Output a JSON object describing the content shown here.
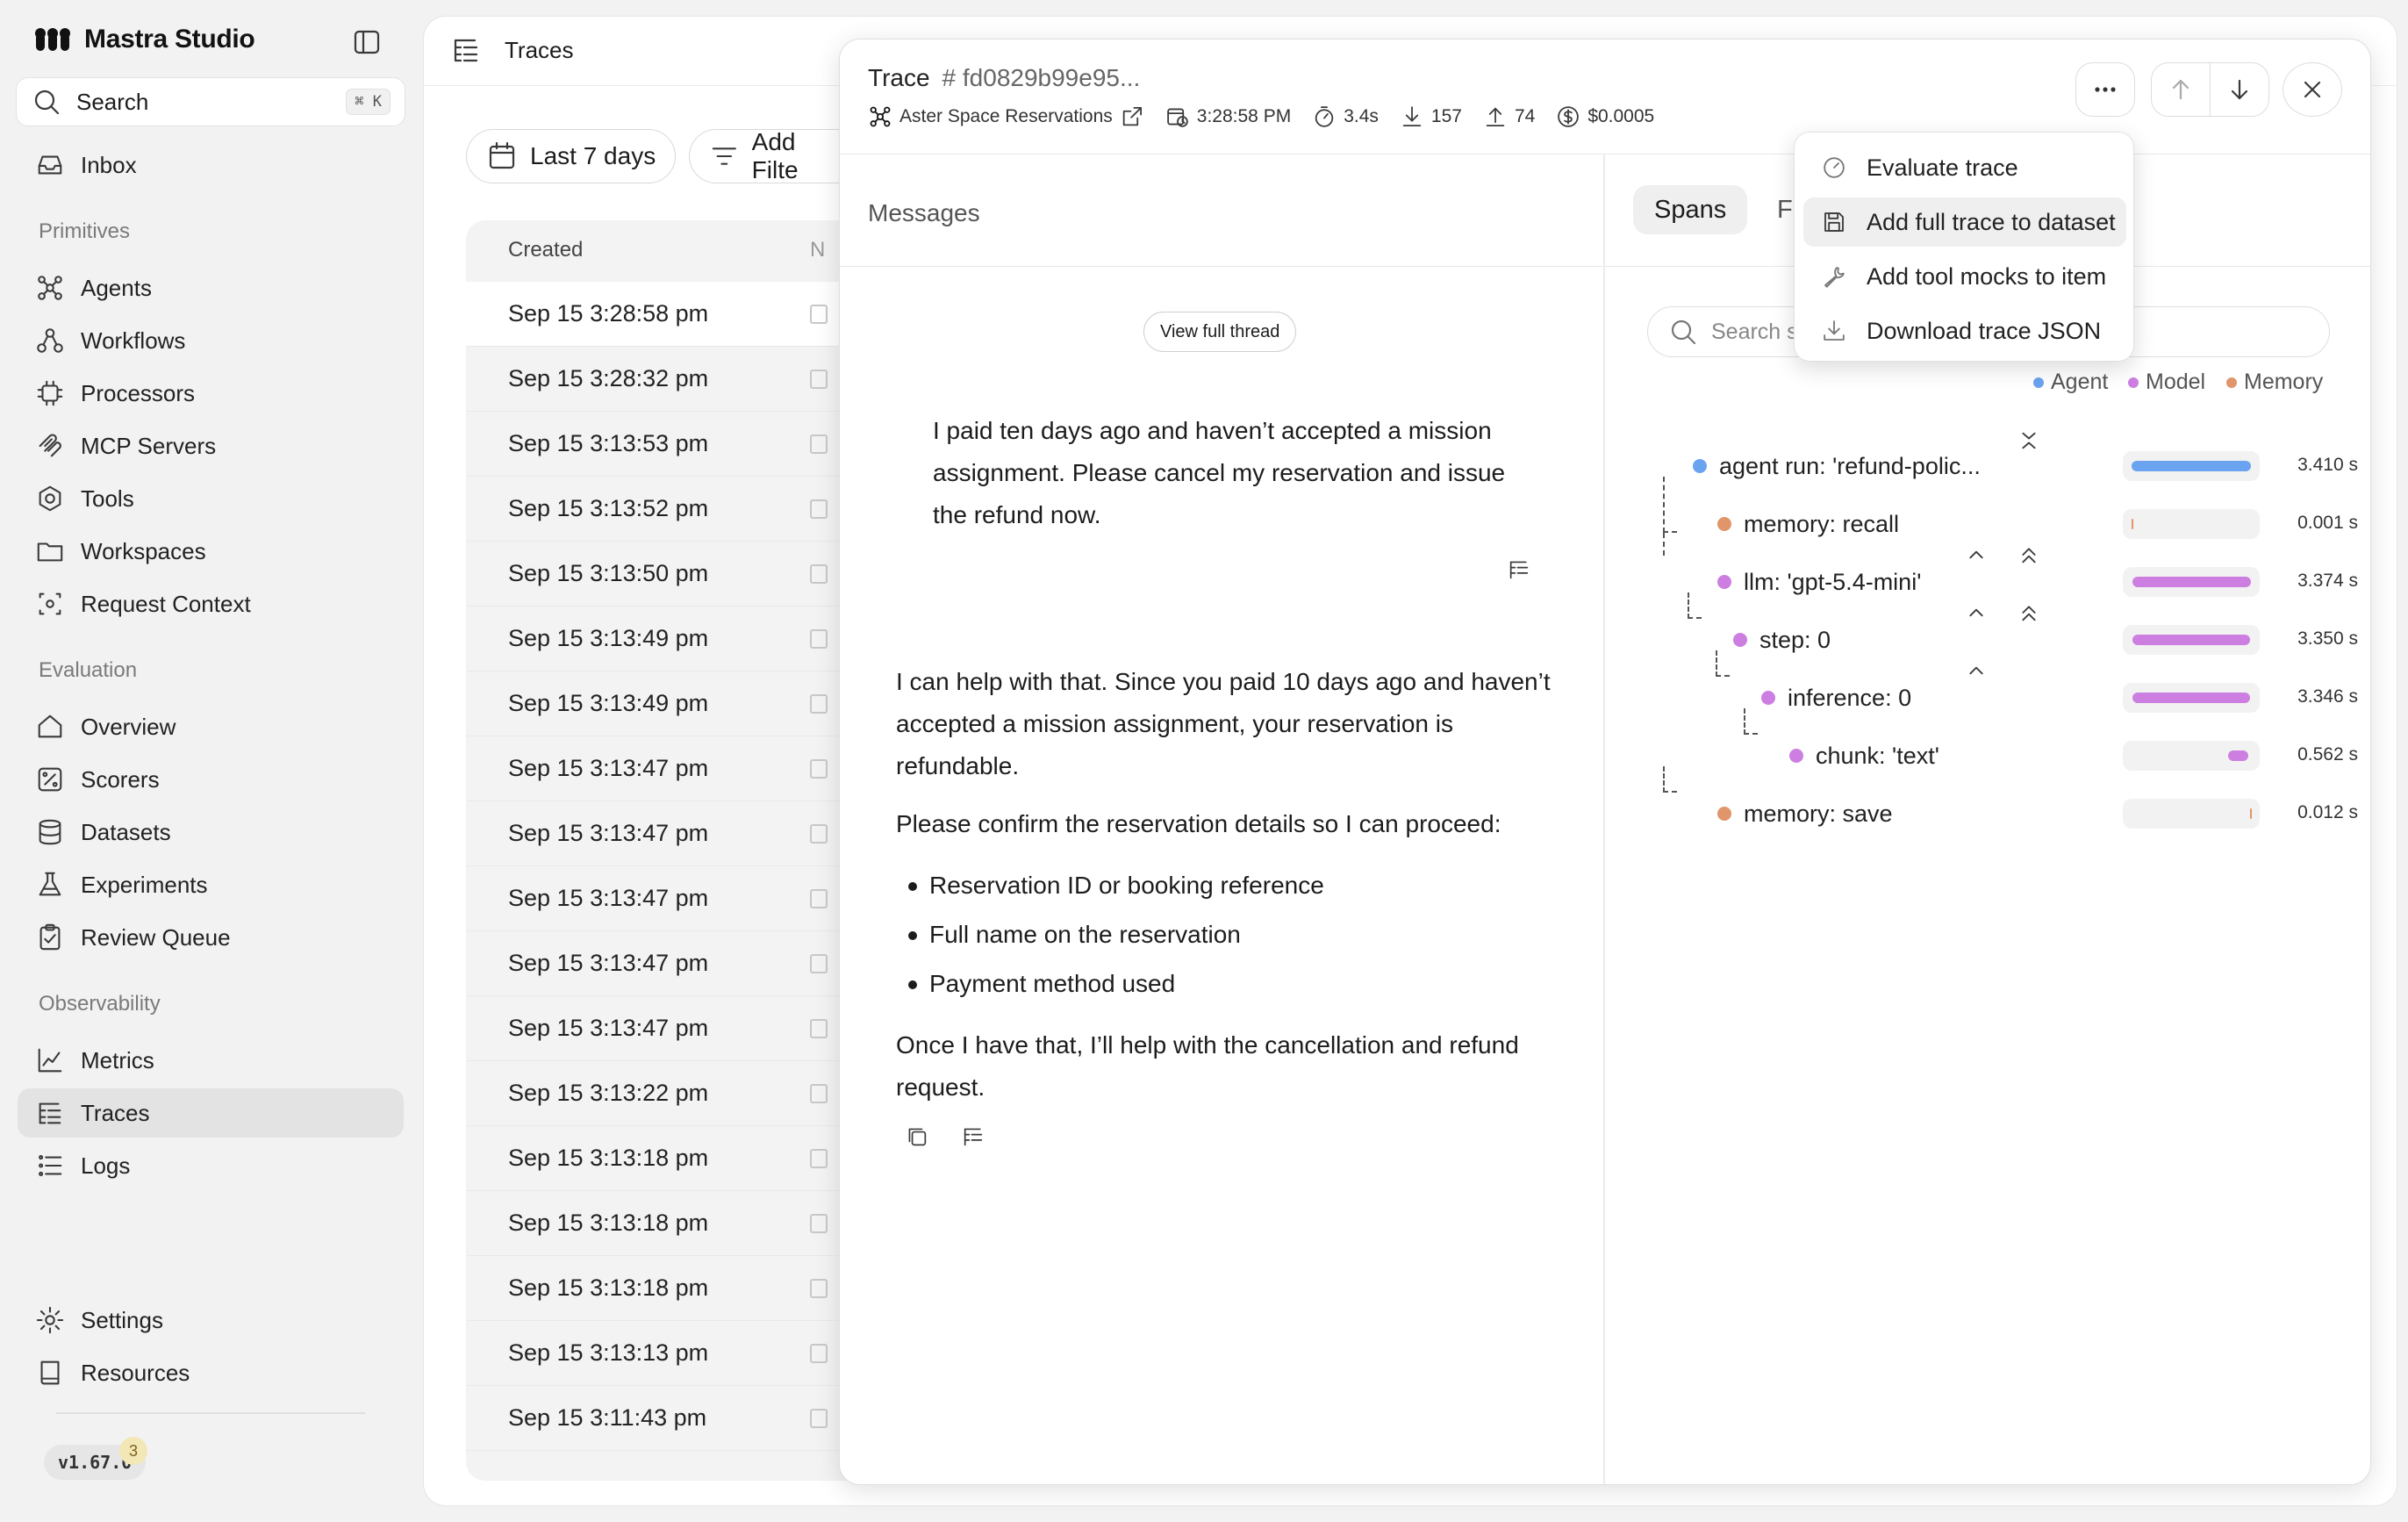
{
  "app": {
    "name": "Mastra Studio",
    "version": "v1.67.0",
    "version_badge": "3"
  },
  "sidebar": {
    "search_label": "Search",
    "search_shortcut": "⌘ K",
    "inbox": "Inbox",
    "sections": {
      "primitives": "Primitives",
      "evaluation": "Evaluation",
      "observability": "Observability"
    },
    "primitives": [
      "Agents",
      "Workflows",
      "Processors",
      "MCP Servers",
      "Tools",
      "Workspaces",
      "Request Context"
    ],
    "evaluation": [
      "Overview",
      "Scorers",
      "Datasets",
      "Experiments",
      "Review Queue"
    ],
    "observability": [
      "Metrics",
      "Traces",
      "Logs"
    ],
    "active": "Traces",
    "footer": [
      "Settings",
      "Resources"
    ]
  },
  "main": {
    "title": "Traces",
    "filters": {
      "date_range": "Last 7 days",
      "add_filter": "Add Filte"
    },
    "table": {
      "column_created": "Created",
      "column_name": "N",
      "rows": [
        "Sep 15 3:28:58 pm",
        "Sep 15 3:28:32 pm",
        "Sep 15 3:13:53 pm",
        "Sep 15 3:13:52 pm",
        "Sep 15 3:13:50 pm",
        "Sep 15 3:13:49 pm",
        "Sep 15 3:13:49 pm",
        "Sep 15 3:13:47 pm",
        "Sep 15 3:13:47 pm",
        "Sep 15 3:13:47 pm",
        "Sep 15 3:13:47 pm",
        "Sep 15 3:13:47 pm",
        "Sep 15 3:13:22 pm",
        "Sep 15 3:13:18 pm",
        "Sep 15 3:13:18 pm",
        "Sep 15 3:13:18 pm",
        "Sep 15 3:13:13 pm",
        "Sep 15 3:11:43 pm"
      ]
    }
  },
  "trace": {
    "label": "Trace",
    "id": "# fd0829b99e95...",
    "agent": "Aster Space Reservations",
    "time": "3:28:58 PM",
    "duration": "3.4s",
    "tokens_in": "157",
    "tokens_out": "74",
    "cost": "$0.0005",
    "messages_label": "Messages",
    "view_thread": "View full thread",
    "user_message": "I paid ten days ago and haven’t accepted a mission assignment. Please cancel my reservation and issue the refund now.",
    "assistant": {
      "p1": "I can help with that. Since you paid 10 days ago and haven’t accepted a mission assignment, your reservation is refundable.",
      "p2": "Please confirm the reservation details so I can proceed:",
      "bullets": [
        "Reservation ID or booking reference",
        "Full name on the reservation",
        "Payment method used"
      ],
      "p3": "Once I have that, I’ll help with the cancellation and refund request."
    },
    "tabs": {
      "spans": "Spans",
      "second": "Fe"
    },
    "span_search_placeholder": "Search sp",
    "legend": [
      {
        "name": "Agent",
        "color": "#6aa3f0"
      },
      {
        "name": "Model",
        "color": "#cc7fe0"
      },
      {
        "name": "Memory",
        "color": "#e0956a"
      }
    ],
    "spans": [
      {
        "name": "agent run: 'refund-polic...",
        "duration": "3.410 s",
        "kind": "agent",
        "start": 0.0,
        "fraction": 1.0
      },
      {
        "name": "memory: recall",
        "duration": "0.001 s",
        "kind": "memory",
        "start": 0.0,
        "fraction": 0.0003
      },
      {
        "name": "llm: 'gpt-5.4-mini'",
        "duration": "3.374 s",
        "kind": "model",
        "start": 0.01,
        "fraction": 0.99
      },
      {
        "name": "step: 0",
        "duration": "3.350 s",
        "kind": "model",
        "start": 0.01,
        "fraction": 0.982
      },
      {
        "name": "inference: 0",
        "duration": "3.346 s",
        "kind": "model",
        "start": 0.01,
        "fraction": 0.981
      },
      {
        "name": "chunk: 'text'",
        "duration": "0.562 s",
        "kind": "model",
        "start": 0.81,
        "fraction": 0.165
      },
      {
        "name": "memory: save",
        "duration": "0.012 s",
        "kind": "memory",
        "start": 0.995,
        "fraction": 0.004
      }
    ],
    "menu": [
      "Evaluate trace",
      "Add full trace to dataset",
      "Add tool mocks to item",
      "Download trace JSON"
    ]
  }
}
